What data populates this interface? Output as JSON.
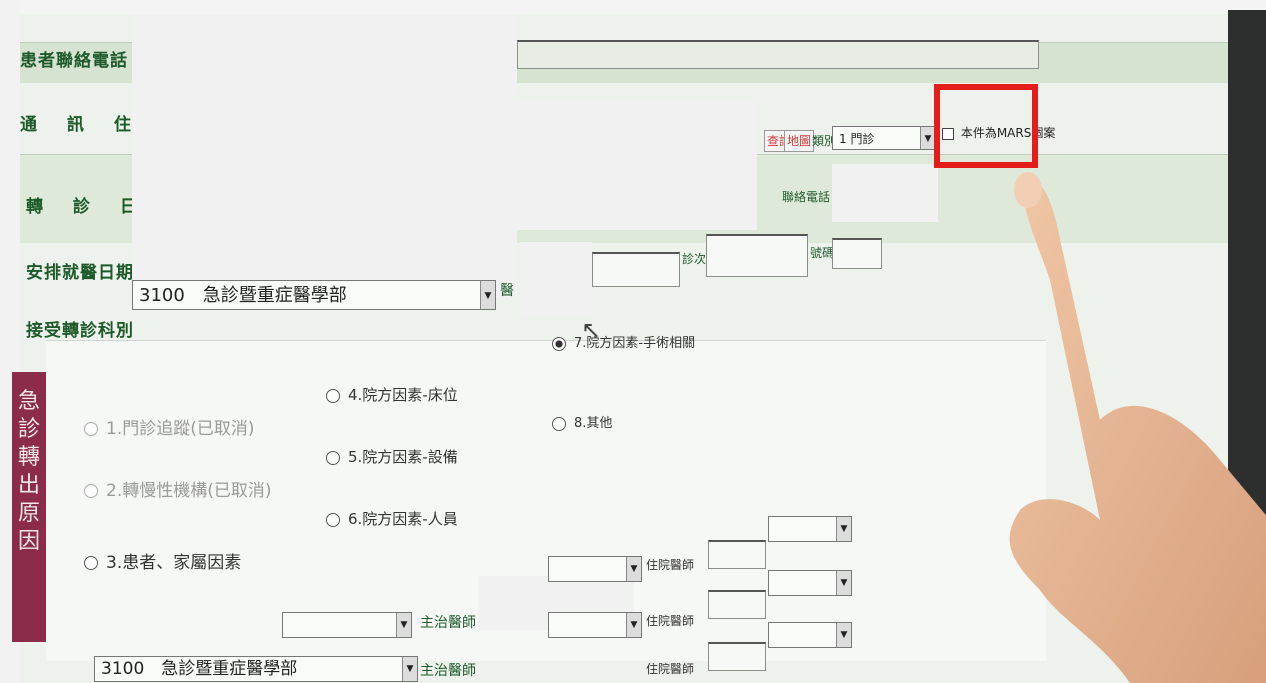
{
  "form": {
    "patient_phone_label": "患者聯絡電話",
    "address_label": "通 訊 住 址",
    "transfer_date_label": "轉 診 日 期",
    "appointment_date_label": "安排就醫日期",
    "receiving_dept_label": "接受轉診科別",
    "receiving_dept_value": "3100　急診暨重症醫學部",
    "doctor_partial_label": "醫",
    "visit_count_label": "診次",
    "number_label": "號碼",
    "contact_phone_label": "聯絡電話",
    "red_btn_1": "查詢",
    "red_btn_2": "地圖",
    "category_label": "類別",
    "category_value": "1 門診",
    "mars_checkbox_label": "本件為MARS個案"
  },
  "reasons": {
    "panel_title": "急診轉出原因",
    "options": [
      {
        "label": "1.門診追蹤(已取消)",
        "state": "disabled"
      },
      {
        "label": "2.轉慢性機構(已取消)",
        "state": "disabled"
      },
      {
        "label": "3.患者、家屬因素",
        "state": "normal"
      },
      {
        "label": "4.院方因素-床位",
        "state": "normal"
      },
      {
        "label": "5.院方因素-設備",
        "state": "normal"
      },
      {
        "label": "6.院方因素-人員",
        "state": "normal"
      },
      {
        "label": "7.院方因素-手術相關",
        "state": "selected"
      },
      {
        "label": "8.其他",
        "state": "normal"
      }
    ]
  },
  "lower": {
    "attending_label": "主治醫師",
    "resident_label": "住院醫師",
    "dept_value": "3100　急診暨重症醫學部"
  }
}
